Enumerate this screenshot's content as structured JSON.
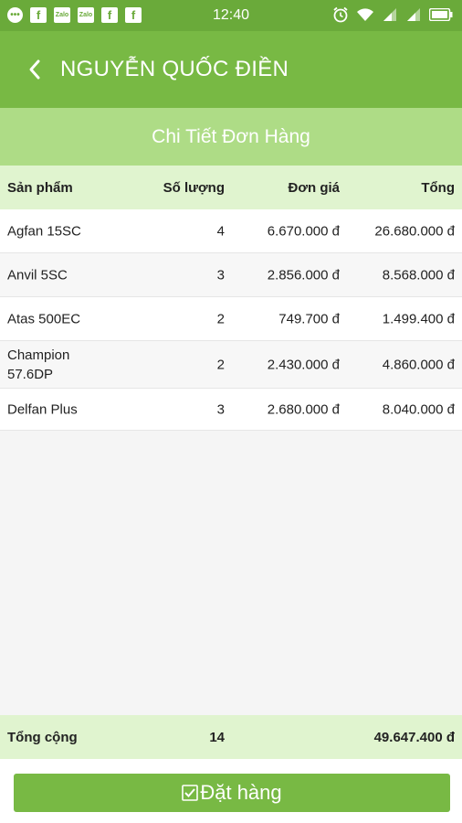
{
  "status_bar": {
    "time": "12:40",
    "left_icons": [
      "message-icon",
      "facebook-icon",
      "zalo-icon",
      "zalo-icon",
      "facebook-icon",
      "facebook-icon"
    ],
    "right_icons": [
      "alarm-icon",
      "wifi-icon",
      "signal-icon",
      "signal-icon",
      "battery-icon"
    ]
  },
  "header": {
    "title": "NGUYỄN QUỐC ĐIỀN",
    "back_icon": "chevron-left-icon"
  },
  "sub_header": {
    "title": "Chi Tiết Đơn Hàng"
  },
  "table": {
    "headers": {
      "name": "Sản phẩm",
      "qty": "Số lượng",
      "price": "Đơn giá",
      "total": "Tổng"
    },
    "rows": [
      {
        "name": "Agfan 15SC",
        "qty": "4",
        "price": "6.670.000 đ",
        "total": "26.680.000 đ"
      },
      {
        "name": "Anvil 5SC",
        "qty": "3",
        "price": "2.856.000 đ",
        "total": "8.568.000 đ"
      },
      {
        "name": "Atas 500EC",
        "qty": "2",
        "price": "749.700 đ",
        "total": "1.499.400 đ"
      },
      {
        "name": "Champion 57.6DP",
        "qty": "2",
        "price": "2.430.000 đ",
        "total": "4.860.000 đ"
      },
      {
        "name": "Delfan Plus",
        "qty": "3",
        "price": "2.680.000 đ",
        "total": "8.040.000 đ"
      }
    ]
  },
  "summary": {
    "label": "Tổng cộng",
    "qty": "14",
    "total": "49.647.400 đ"
  },
  "order_button": {
    "label": "Đặt hàng",
    "icon": "checkbox-icon"
  },
  "colors": {
    "status_bar": "#6aaa3a",
    "app_bar": "#78b944",
    "sub_header": "#aedc86",
    "table_header": "#e0f4cf"
  }
}
